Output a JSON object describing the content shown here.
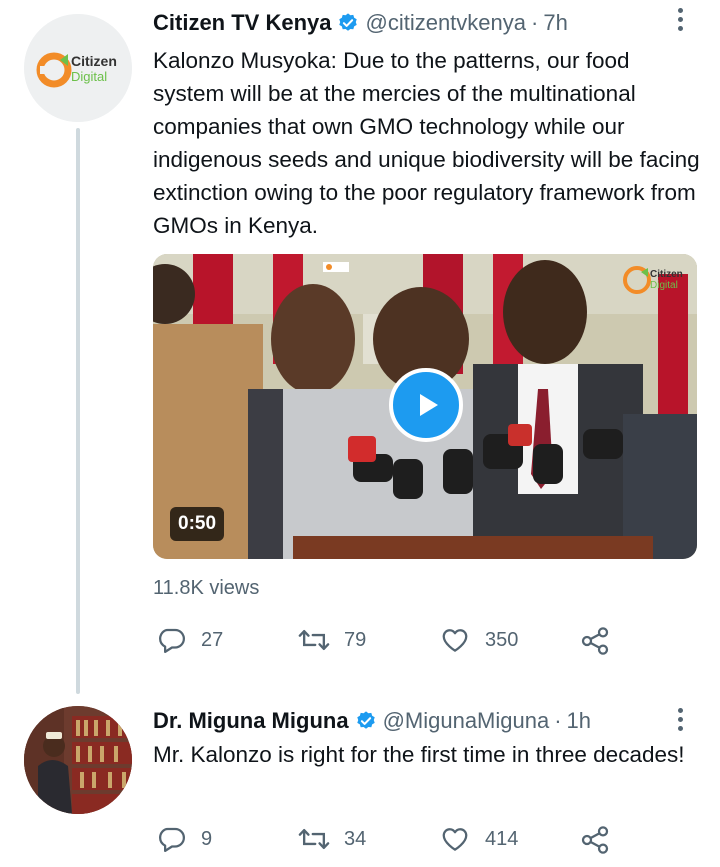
{
  "tweets": [
    {
      "author": {
        "name": "Citizen TV Kenya",
        "handle": "@citizentvkenya",
        "time": "7h",
        "avatar_logo_text": [
          "Citizen",
          "Digital"
        ]
      },
      "text": "Kalonzo Musyoka: Due to the patterns, our food system will be at the mercies of the multinational companies that own GMO technology while our indigenous seeds and unique biodiversity will be facing extinction owing to the poor regulatory framework from GMOs in Kenya.",
      "media": {
        "type": "video",
        "duration": "0:50",
        "watermark": [
          "Citizen",
          "Digital"
        ]
      },
      "views": "11.8K views",
      "stats": {
        "replies": "27",
        "retweets": "79",
        "likes": "350"
      }
    },
    {
      "author": {
        "name": "Dr. Miguna Miguna",
        "handle": "@MigunaMiguna",
        "time": "1h"
      },
      "text": "Mr. Kalonzo is right for the first time in three decades!",
      "stats": {
        "replies": "9",
        "retweets": "34",
        "likes": "414"
      }
    }
  ],
  "icons": {
    "verified": "verified-badge-icon",
    "more": "more-options-icon",
    "reply": "reply-icon",
    "retweet": "retweet-icon",
    "like": "heart-icon",
    "share": "share-icon",
    "play": "play-icon"
  },
  "colors": {
    "accent": "#1d9bf0",
    "text": "#0f1419",
    "secondary": "#536471",
    "thread_line": "#cfd9de",
    "brand_orange": "#f28c28",
    "brand_green": "#6cc04a"
  }
}
